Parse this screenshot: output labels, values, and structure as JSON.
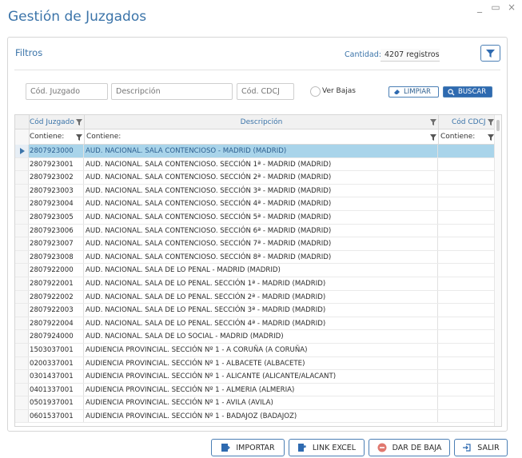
{
  "window": {
    "title": "Gestión de Juzgados",
    "controls": [
      "_",
      "▭",
      "×"
    ]
  },
  "filters": {
    "section_title": "Filtros",
    "cantidad_label": "Cantidad:",
    "cantidad_value": "4207 registros",
    "cod_juzgado_placeholder": "Cód. Juzgado",
    "descripcion_placeholder": "Descripción",
    "cod_cdcj_placeholder": "Cód. CDCJ",
    "ver_bajas_label": "Ver Bajas",
    "limpiar_label": "LIMPIAR",
    "buscar_label": "BUSCAR"
  },
  "grid": {
    "headers": {
      "cod_juzgado": "Cód Juzgado",
      "descripcion": "Descripción",
      "cod_cdcj": "Cód CDCJ"
    },
    "filter_row": {
      "cod_juzgado": "Contiene:",
      "descripcion": "Contiene:",
      "cod_cdcj": "Contiene:"
    },
    "rows": [
      {
        "code": "2807923000",
        "desc": "AUD. NACIONAL. SALA CONTENCIOSO - MADRID (MADRID)"
      },
      {
        "code": "2807923001",
        "desc": "AUD. NACIONAL. SALA CONTENCIOSO. SECCIÓN 1ª - MADRID (MADRID)"
      },
      {
        "code": "2807923002",
        "desc": "AUD. NACIONAL. SALA CONTENCIOSO. SECCIÓN 2ª - MADRID (MADRID)"
      },
      {
        "code": "2807923003",
        "desc": "AUD. NACIONAL. SALA CONTENCIOSO. SECCIÓN 3ª - MADRID (MADRID)"
      },
      {
        "code": "2807923004",
        "desc": "AUD. NACIONAL. SALA CONTENCIOSO. SECCIÓN 4ª - MADRID (MADRID)"
      },
      {
        "code": "2807923005",
        "desc": "AUD. NACIONAL. SALA CONTENCIOSO. SECCIÓN 5ª - MADRID (MADRID)"
      },
      {
        "code": "2807923006",
        "desc": "AUD. NACIONAL. SALA CONTENCIOSO. SECCIÓN 6ª - MADRID (MADRID)"
      },
      {
        "code": "2807923007",
        "desc": "AUD. NACIONAL. SALA CONTENCIOSO. SECCIÓN 7ª - MADRID (MADRID)"
      },
      {
        "code": "2807923008",
        "desc": "AUD. NACIONAL. SALA CONTENCIOSO. SECCIÓN 8ª - MADRID (MADRID)"
      },
      {
        "code": "2807922000",
        "desc": "AUD. NACIONAL. SALA DE LO PENAL - MADRID (MADRID)"
      },
      {
        "code": "2807922001",
        "desc": "AUD. NACIONAL. SALA DE LO PENAL. SECCIÓN 1ª - MADRID (MADRID)"
      },
      {
        "code": "2807922002",
        "desc": "AUD. NACIONAL. SALA DE LO PENAL. SECCIÓN 2ª - MADRID (MADRID)"
      },
      {
        "code": "2807922003",
        "desc": "AUD. NACIONAL. SALA DE LO PENAL. SECCIÓN 3ª - MADRID (MADRID)"
      },
      {
        "code": "2807922004",
        "desc": "AUD. NACIONAL. SALA DE LO PENAL. SECCIÓN 4ª - MADRID (MADRID)"
      },
      {
        "code": "2807924000",
        "desc": "AUD. NACIONAL. SALA DE LO SOCIAL - MADRID (MADRID)"
      },
      {
        "code": "1503037001",
        "desc": "AUDIENCIA PROVINCIAL. SECCIÓN Nº 1 - A CORUÑA (A CORUÑA)"
      },
      {
        "code": "0200337001",
        "desc": "AUDIENCIA PROVINCIAL. SECCIÓN Nº 1 - ALBACETE (ALBACETE)"
      },
      {
        "code": "0301437001",
        "desc": "AUDIENCIA PROVINCIAL. SECCIÓN Nº 1 - ALICANTE (ALICANTE/ALACANT)"
      },
      {
        "code": "0401337001",
        "desc": "AUDIENCIA PROVINCIAL. SECCIÓN Nº 1 - ALMERIA (ALMERIA)"
      },
      {
        "code": "0501937001",
        "desc": "AUDIENCIA PROVINCIAL. SECCIÓN Nº 1 - AVILA (AVILA)"
      },
      {
        "code": "0601537001",
        "desc": "AUDIENCIA PROVINCIAL. SECCIÓN Nº 1 - BADAJOZ (BADAJOZ)"
      }
    ]
  },
  "footer": {
    "importar": "IMPORTAR",
    "link_excel": "LINK EXCEL",
    "dar_de_baja": "DAR DE BAJA",
    "salir": "SALIR"
  },
  "colors": {
    "accent": "#3b74a9",
    "button_border": "#4b7fb5",
    "buscar_bg": "#2e6ab0",
    "selected_row": "#a9d4ea",
    "baja_icon": "#e0786f"
  }
}
